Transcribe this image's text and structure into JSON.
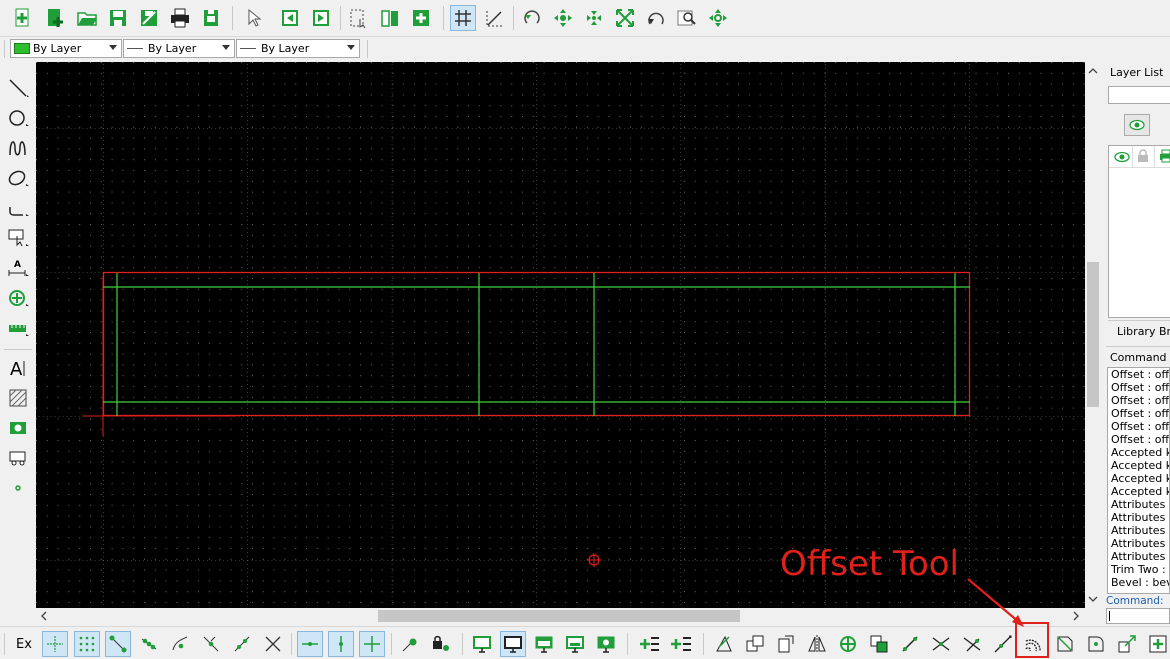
{
  "layer_combos": [
    {
      "label": "By Layer",
      "color": "#2dbe2d"
    },
    {
      "label": "By Layer"
    },
    {
      "label": "By Layer"
    }
  ],
  "layer_panel": {
    "title": "Layer List"
  },
  "library_panel": {
    "title": "Library Bro"
  },
  "command_panel": {
    "title": "Command lin",
    "log": [
      "Offset : offs",
      "Offset : offs",
      "Offset : offs",
      "Offset : offs",
      "Offset : offs",
      "Offset : offs",
      "Accepted ke",
      "Accepted ke",
      "Accepted ke",
      "Accepted ke",
      "Attributes : ",
      "Attributes : ",
      "Attributes : ",
      "Attributes : ",
      "Attributes : ",
      "Trim Two : tr",
      "Bevel : beve"
    ],
    "prompt_label": "Command:"
  },
  "snap_toolbar": {
    "label": "Ex"
  },
  "annotation": {
    "text": "Offset Tool",
    "color": "#e0201a"
  },
  "colors": {
    "canvas_bg": "#000000",
    "outline_red": "#e0201a",
    "offset_green": "#3ed23e",
    "icon_green": "#1f9e3a"
  }
}
